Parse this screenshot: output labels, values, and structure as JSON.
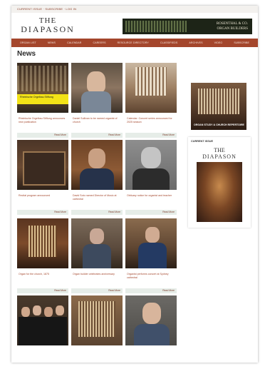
{
  "topbar": {
    "text": "CURRENT ISSUE  ·  SUBSCRIBE  ·  LOG IN"
  },
  "header": {
    "logo_the": "THE",
    "logo_name": "DIAPASON",
    "banner_brand_line1": "ROSENTHAL & CO.",
    "banner_brand_line2": "ORGAN BUILDERS"
  },
  "nav": {
    "items": [
      "ORGAN LIST",
      "NEWS",
      "CALENDAR",
      "CAREERS",
      "RESOURCE DIRECTORY",
      "CLASSIFIEDS",
      "ARCHIVES",
      "VIDEO",
      "SUBSCRIBE"
    ]
  },
  "news": {
    "title": "News",
    "cards": [
      {
        "caption": "Rheinische Orgelbau Stiftung announces new publication",
        "read_more": "Read More"
      },
      {
        "caption": "Daniel Sullivan to be named organist of church",
        "read_more": "Read More"
      },
      {
        "caption": "Calendar: Concert series announced for 2025 season",
        "read_more": "Read More"
      },
      {
        "caption": "Recital program announced",
        "read_more": "Read More"
      },
      {
        "caption": "David Soto named Director of Music at cathedral",
        "read_more": "Read More"
      },
      {
        "caption": "Obituary notice for organist and teacher",
        "read_more": "Read More"
      },
      {
        "caption": "Organ for the church, 1875",
        "read_more": "Read More"
      },
      {
        "caption": "Organ builder celebrates anniversary",
        "read_more": "Read More"
      },
      {
        "caption": "Organist performs concert at Sydney cathedral",
        "read_more": "Read More"
      },
      {
        "caption": "",
        "read_more": ""
      },
      {
        "caption": "",
        "read_more": ""
      },
      {
        "caption": "",
        "read_more": ""
      }
    ],
    "card1_band": "Rheinische Orgelbau Stiftung"
  },
  "sidebar": {
    "ad_text": "ORGAN STUDY & CHURCH REPERTOIRE",
    "current_issue_label": "CURRENT ISSUE",
    "cover_the": "THE",
    "cover_name": "DIAPASON"
  }
}
